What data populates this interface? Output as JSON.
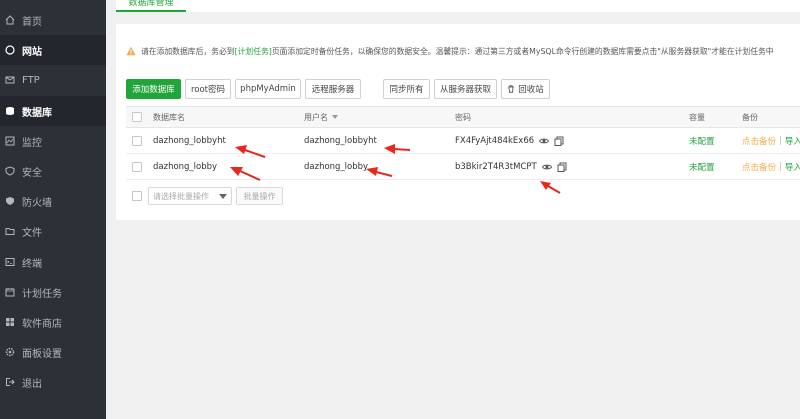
{
  "sidebar": {
    "items": [
      {
        "label": "首页",
        "icon": "home-icon"
      },
      {
        "label": "网站",
        "icon": "globe-icon"
      },
      {
        "label": "FTP",
        "icon": "ftp-icon"
      },
      {
        "label": "数据库",
        "icon": "database-icon"
      },
      {
        "label": "监控",
        "icon": "monitor-icon"
      },
      {
        "label": "安全",
        "icon": "shield-icon"
      },
      {
        "label": "防火墙",
        "icon": "firewall-icon"
      },
      {
        "label": "文件",
        "icon": "folder-icon"
      },
      {
        "label": "终端",
        "icon": "terminal-icon"
      },
      {
        "label": "计划任务",
        "icon": "calendar-icon"
      },
      {
        "label": "软件商店",
        "icon": "store-icon"
      },
      {
        "label": "面板设置",
        "icon": "settings-icon"
      },
      {
        "label": "退出",
        "icon": "logout-icon"
      }
    ],
    "active_label": "数据库"
  },
  "tab": {
    "label": "数据库管理"
  },
  "notice": {
    "before": "请在添加数据库后，务必到",
    "link": "[计划任务]",
    "after": "页面添加定时备份任务，以确保您的数据安全。温馨提示：通过第三方或者MySQL命令行创建的数据库需要点击\"从服务器获取\"才能在计划任务中"
  },
  "toolbar": {
    "add": "添加数据库",
    "root_password": "root密码",
    "phpmyadmin": "phpMyAdmin",
    "remote_server": "远程服务器",
    "sync_all": "同步所有",
    "fetch_from_server": "从服务器获取",
    "recycle_bin": "回收站"
  },
  "table": {
    "headers": {
      "name": "数据库名",
      "user": "用户名",
      "password": "密码",
      "capacity": "容量",
      "backup": "备份"
    },
    "rows": [
      {
        "name": "dazhong_lobbyht",
        "user": "dazhong_lobbyht",
        "password": "FX4FyAjt484kEx66",
        "capacity": "未配置",
        "backup": "点击备份",
        "import": "导入"
      },
      {
        "name": "dazhong_lobby",
        "user": "dazhong_lobby",
        "password": "b3Bkir2T4R3tMCPT",
        "capacity": "未配置",
        "backup": "点击备份",
        "import": "导入"
      }
    ]
  },
  "batch": {
    "placeholder": "请选择批量操作",
    "button": "批量操作"
  },
  "colors": {
    "sidebar_bg": "#2c3138",
    "accent": "#20a53a",
    "warning": "#f0ad4e",
    "annotation": "#e8271d"
  }
}
